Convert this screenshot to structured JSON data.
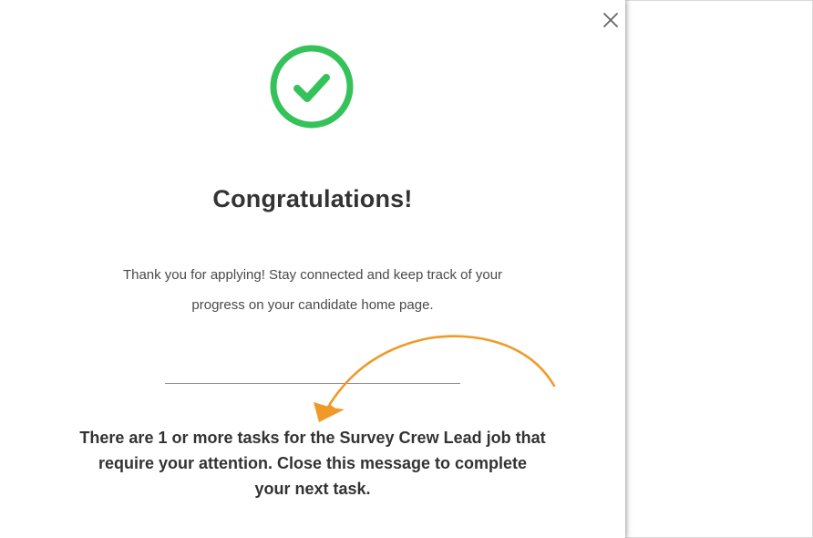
{
  "dialog": {
    "close_icon": "close-icon",
    "success_icon": "check-circle-icon",
    "title": "Congratulations!",
    "message_line1": "Thank you for applying! Stay connected and keep track of your",
    "message_line2": "progress on your candidate home page.",
    "tasks_line1": "There are 1 or more tasks for the Survey Crew Lead job that",
    "tasks_line2": "require your attention. Close this message to complete",
    "tasks_line3": "your next task."
  },
  "annotation": {
    "arrow_icon": "curved-arrow-icon",
    "arrow_color": "#ef9a28"
  },
  "colors": {
    "success_green": "#35c25a",
    "title_text": "#333333",
    "body_text": "#4a4a4a"
  }
}
